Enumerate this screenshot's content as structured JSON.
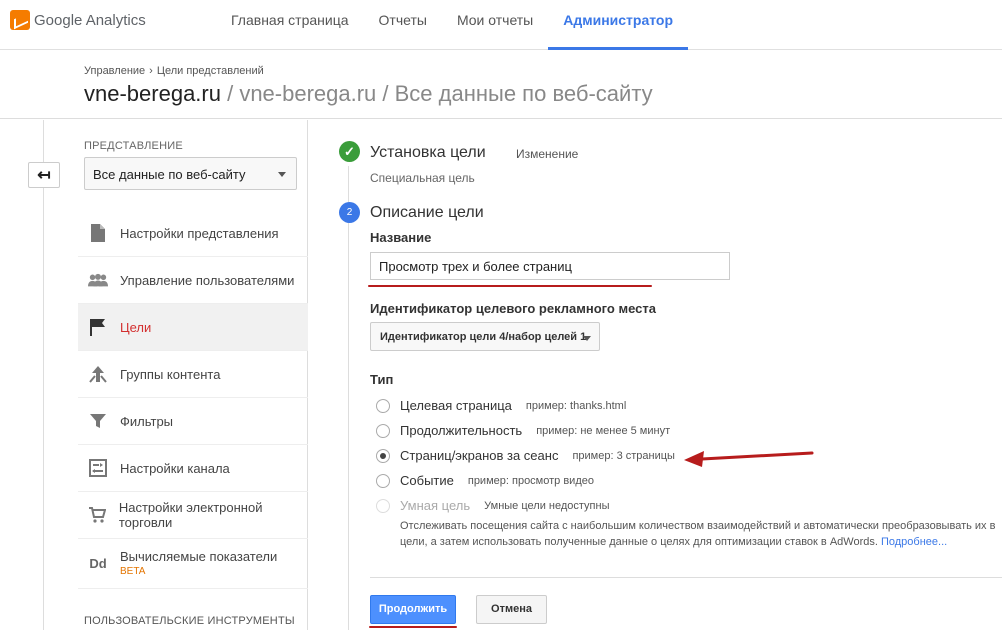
{
  "topbar": {
    "brand": "Google Analytics",
    "nav": [
      "Главная страница",
      "Отчеты",
      "Мои отчеты",
      "Администратор"
    ]
  },
  "header": {
    "breadcrumb": [
      "Управление",
      "Цели представлений"
    ],
    "title_main": "vne-berega.ru",
    "title_sub": " / vne-berega.ru / Все данные по веб-сайту"
  },
  "sidebar": {
    "back_icon": "↤",
    "view_label": "ПРЕДСТАВЛЕНИЕ",
    "view_value": "Все данные по веб-сайту",
    "items": [
      {
        "label": "Настройки представления",
        "icon": "document-icon"
      },
      {
        "label": "Управление пользователями",
        "icon": "users-icon"
      },
      {
        "label": "Цели",
        "icon": "flag-icon"
      },
      {
        "label": "Группы контента",
        "icon": "content-groups-icon"
      },
      {
        "label": "Фильтры",
        "icon": "filter-icon"
      },
      {
        "label": "Настройки канала",
        "icon": "channel-icon"
      },
      {
        "label": "Настройки электронной торговли",
        "icon": "cart-icon"
      },
      {
        "label": "Вычисляемые показатели",
        "icon": "dd-icon",
        "badge": "BETA",
        "icon_text": "Dd"
      }
    ],
    "active_index": 2,
    "tools_label": "ПОЛЬЗОВАТЕЛЬСКИЕ ИНСТРУМЕНТЫ"
  },
  "goal": {
    "step1": {
      "title": "Установка цели",
      "edit": "Изменение",
      "subtitle": "Специальная цель"
    },
    "step2": {
      "number": "2",
      "title": "Описание цели"
    },
    "name_label": "Название",
    "name_value": "Просмотр трех и более страниц",
    "slot_label": "Идентификатор целевого рекламного места",
    "slot_value": "Идентификатор цели 4/набор целей 1",
    "type_label": "Тип",
    "types": [
      {
        "label": "Целевая страница",
        "example": "пример: thanks.html",
        "checked": false,
        "disabled": false
      },
      {
        "label": "Продолжительность",
        "example": "пример: не менее 5 минут",
        "checked": false,
        "disabled": false
      },
      {
        "label": "Страниц/экранов за сеанс",
        "example": "пример: 3 страницы",
        "checked": true,
        "disabled": false
      },
      {
        "label": "Событие",
        "example": "пример: просмотр видео",
        "checked": false,
        "disabled": false
      },
      {
        "label": "Умная цель",
        "example": "Умные цели недоступны",
        "checked": false,
        "disabled": true
      }
    ],
    "smart_desc": "Отслеживать посещения сайта с наибольшим количеством взаимодействий и автоматически преобразовывать их в цели, а затем использовать полученные данные о целях для оптимизации ставок в AdWords.",
    "smart_link": "Подробнее...",
    "continue_label": "Продолжить",
    "cancel_label": "Отмена"
  },
  "colors": {
    "accent": "#3b78e7",
    "active_red": "#d32f2f",
    "annotation_red": "#b71c1c",
    "success": "#3a9d3a"
  }
}
